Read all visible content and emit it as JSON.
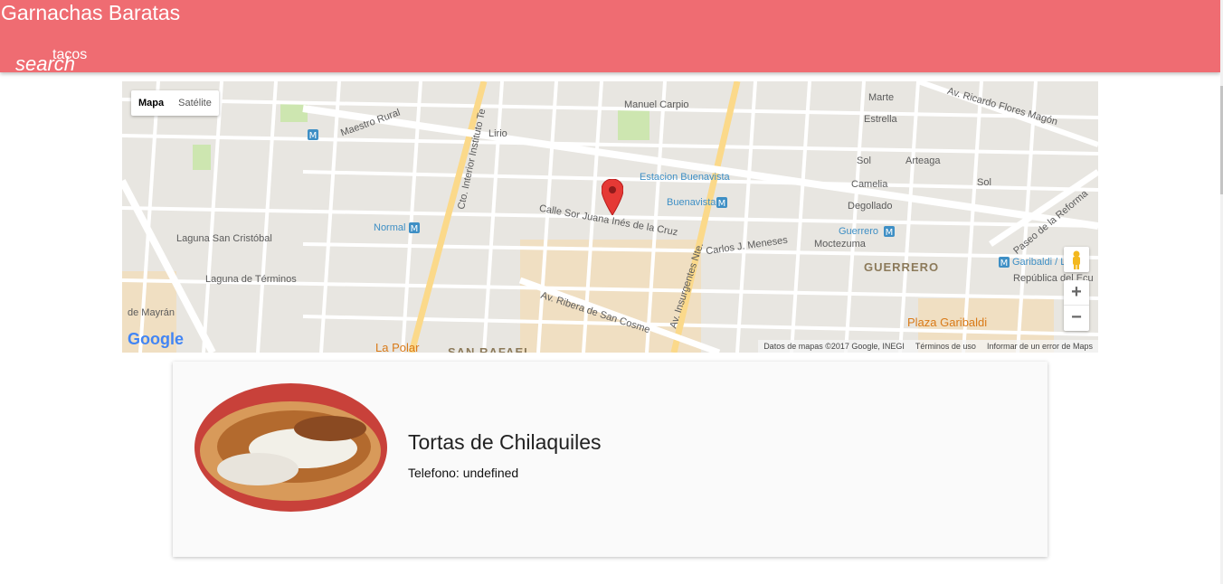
{
  "app": {
    "title": "Garnachas Baratas"
  },
  "search": {
    "label": "search",
    "value": "tacos"
  },
  "map": {
    "type_controls": [
      "Mapa",
      "Satélite"
    ],
    "active_type": "Mapa",
    "labels": {
      "manuel_carpio": "Manuel Carpio",
      "maestro_rural": "Maestro Rural",
      "lirio": "Lirio",
      "estacion_buenavista": "Estacion Buenavista",
      "buenavista": "Buenavista",
      "calle_sor_juana": "Calle Sor Juana Inés de la Cruz",
      "carlos_meneses": "Carlos J. Meneses",
      "normal": "Normal",
      "laguna_san_cristobal": "Laguna San Cristóbal",
      "laguna_de_terminos": "Laguna de Términos",
      "av_ribera": "Av. Ribera de San Cosme",
      "la_polar": "La Polar",
      "san_rafael": "SAN RAFAEL",
      "de_mayran": "de Mayrán",
      "marte": "Marte",
      "estrella": "Estrella",
      "sol": "Sol",
      "arteaga": "Arteaga",
      "camelia": "Camelia",
      "degollado": "Degollado",
      "guerrero_station": "Guerrero",
      "moctezuma": "Moctezuma",
      "guerrero_district": "GUERRERO",
      "republica_ecu": "República del Ecu",
      "plaza_garibaldi": "Plaza Garibaldi",
      "garibaldi": "Garibaldi / L",
      "av_ricardo_flores_magon": "Av. Ricardo Flores Magón",
      "paseo_reforma": "Paseo de la Reforma",
      "av_insurgentes": "Av. Insurgentes Nte.",
      "cto_interior": "Cto. Interior Instituto Te",
      "google": "Google"
    },
    "attribution": [
      "Datos de mapas ©2017 Google, INEGI",
      "Términos de uso",
      "Informar de un error de Maps"
    ],
    "zoom_in": "+",
    "zoom_out": "−"
  },
  "card": {
    "title": "Tortas de Chilaquiles",
    "phone_label": "Telefono:",
    "phone_value": "undefined"
  }
}
